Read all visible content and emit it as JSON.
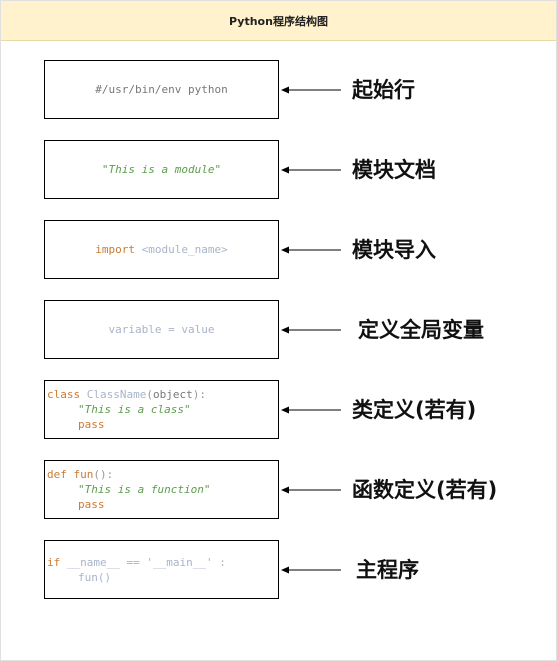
{
  "header": {
    "title": "Python程序结构图"
  },
  "blocks": [
    {
      "id": "shebang",
      "code": "#/usr/bin/env python",
      "label": "起始行"
    },
    {
      "id": "docstring",
      "code": "\"This is a module\"",
      "label": "模块文档"
    },
    {
      "id": "import",
      "keyword": "import",
      "arg": "<module_name>",
      "label": "模块导入"
    },
    {
      "id": "global",
      "code": "variable = value",
      "label": "定义全局变量"
    },
    {
      "id": "class",
      "kw": "class",
      "name": "ClassName",
      "paren_open": "(",
      "base": "object",
      "paren_close": "):",
      "doc": "\"This is a class\"",
      "body": "pass",
      "label": "类定义(若有)"
    },
    {
      "id": "function",
      "kw": "def",
      "name": "fun",
      "sig": "():",
      "doc": "\"This is a function\"",
      "body": "pass",
      "label": "函数定义(若有)"
    },
    {
      "id": "main",
      "kw": "if",
      "cond": "__name__ == '__main__' :",
      "call": "fun()",
      "label": "主程序"
    }
  ]
}
